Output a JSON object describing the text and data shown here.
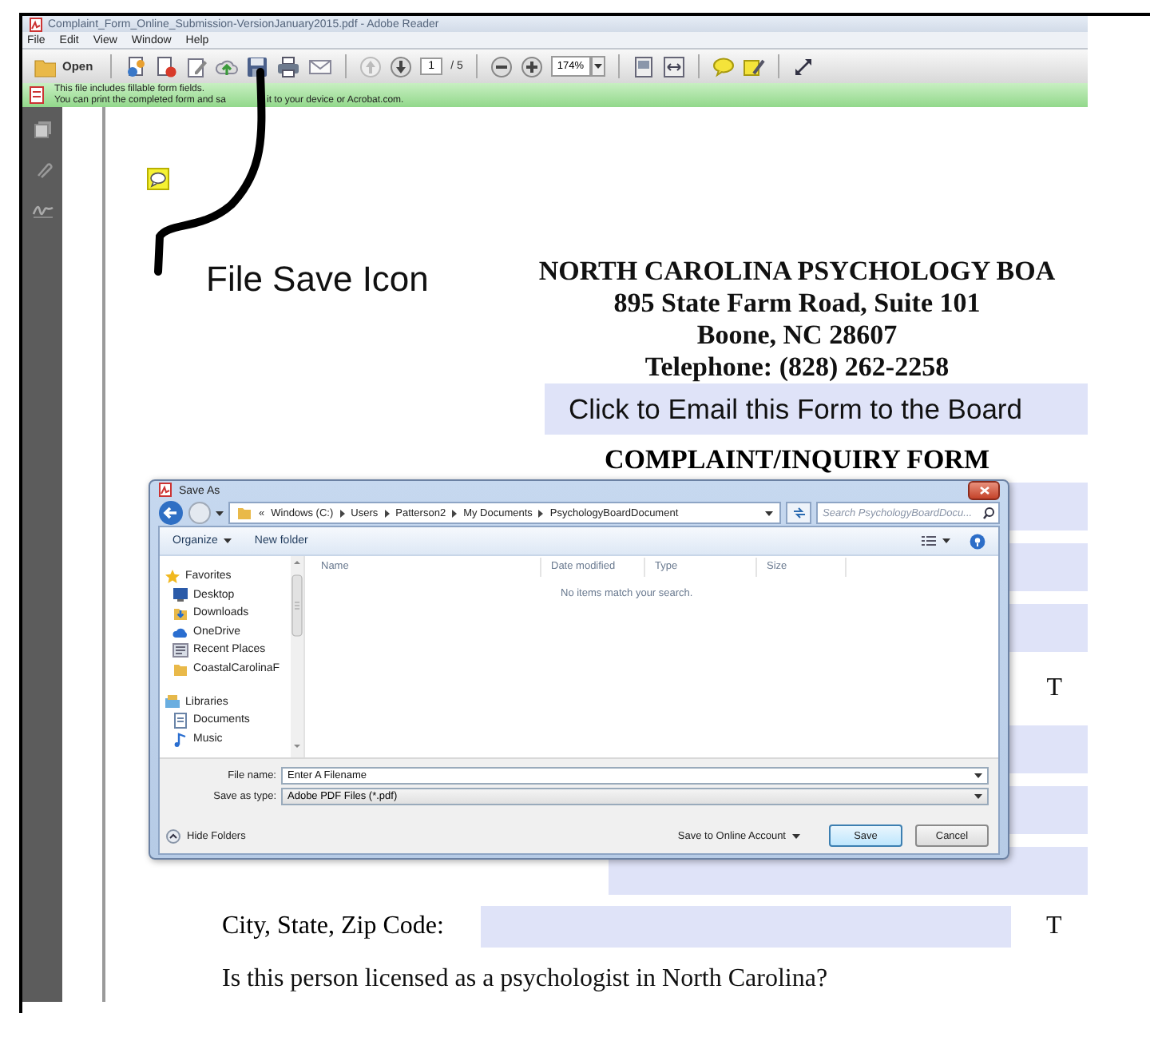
{
  "window": {
    "title": "Complaint_Form_Online_Submission-VersionJanuary2015.pdf - Adobe Reader"
  },
  "menu": [
    "File",
    "Edit",
    "View",
    "Window",
    "Help"
  ],
  "toolbar": {
    "open_label": "Open",
    "page": "1",
    "page_count": "/ 5",
    "zoom": "174%"
  },
  "notice": [
    {
      "parts": [
        "This file includes fillable form fields."
      ]
    },
    {
      "parts": [
        "You can print the completed form and sa",
        "it to your device or Acrobat.com."
      ]
    }
  ],
  "annotation": {
    "label": "File Save Icon"
  },
  "document": {
    "heading": [
      "NORTH CAROLINA PSYCHOLOGY BOA",
      "895 State Farm Road, Suite 101",
      "Boone, NC  28607",
      "Telephone:  (828) 262-2258"
    ],
    "email_button": "Click to Email this Form to the Board",
    "form_title": "COMPLAINT/INQUIRY FORM",
    "row_label": "T",
    "city_label": "City, State, Zip Code:",
    "city_side_label": "T",
    "question": "Is this person licensed as a psychologist in North Carolina?"
  },
  "dialog": {
    "title": "Save As",
    "path_prefix": "«",
    "path": [
      "Windows (C:)",
      "Users",
      "Patterson2",
      "My Documents",
      "PsychologyBoardDocument"
    ],
    "search_placeholder": "Search PsychologyBoardDocu...",
    "organize": "Organize",
    "new_folder": "New folder",
    "nav": [
      {
        "label": "Favorites",
        "kind": "star",
        "children": [
          {
            "label": "Desktop",
            "kind": "desktop"
          },
          {
            "label": "Downloads",
            "kind": "download"
          },
          {
            "label": "OneDrive",
            "kind": "cloud"
          },
          {
            "label": "Recent Places",
            "kind": "recent"
          },
          {
            "label": "CoastalCarolinaF",
            "kind": "folder"
          }
        ]
      },
      {
        "label": "Libraries",
        "kind": "library",
        "children": [
          {
            "label": "Documents",
            "kind": "document"
          },
          {
            "label": "Music",
            "kind": "music"
          }
        ]
      }
    ],
    "columns": [
      "Name",
      "Date modified",
      "Type",
      "Size"
    ],
    "empty_message": "No items match your search.",
    "file_name_label": "File name:",
    "file_name": "Enter A Filename",
    "type_label": "Save as type:",
    "file_type": "Adobe PDF Files (*.pdf)",
    "hide_folders": "Hide Folders",
    "online": "Save to Online Account",
    "buttons": [
      {
        "label": "Save",
        "default": true
      },
      {
        "label": "Cancel",
        "default": false
      }
    ]
  }
}
